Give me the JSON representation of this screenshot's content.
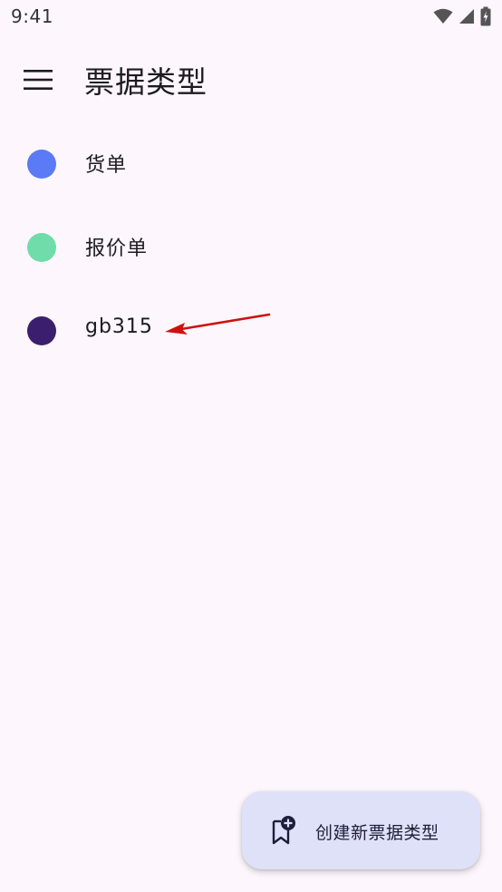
{
  "status_bar": {
    "time": "9:41"
  },
  "app_bar": {
    "title": "票据类型",
    "menu_icon": "hamburger-menu-icon"
  },
  "list": {
    "items": [
      {
        "label": "货单",
        "color": "#5b7af5"
      },
      {
        "label": "报价单",
        "color": "#6fdcaa"
      },
      {
        "label": "gb315",
        "color": "#3b1f6e"
      }
    ]
  },
  "fab": {
    "label": "创建新票据类型",
    "icon": "bookmark-add-icon",
    "background": "#dfe1f8"
  },
  "colors": {
    "background": "#fdf7fd",
    "annotation_arrow": "#d01010"
  }
}
